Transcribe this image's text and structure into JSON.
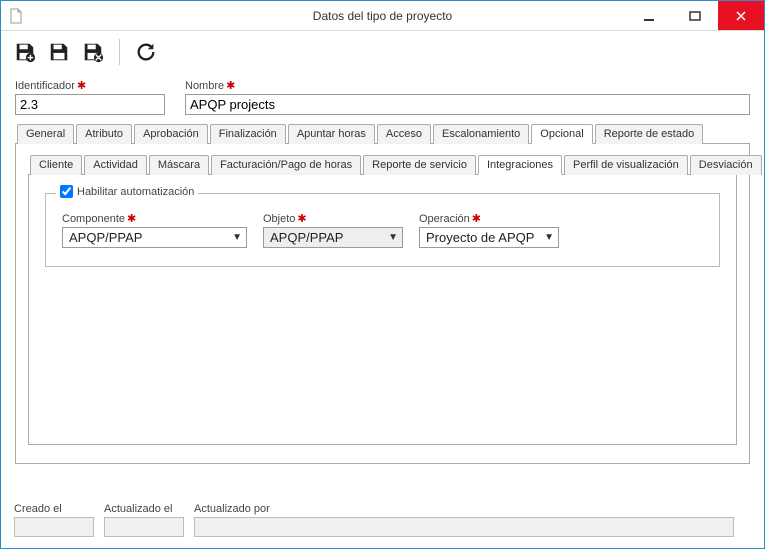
{
  "window": {
    "title": "Datos del tipo de proyecto"
  },
  "fields": {
    "id_label": "Identificador",
    "id_value": "2.3",
    "name_label": "Nombre",
    "name_value": "APQP projects"
  },
  "tabs_main": {
    "general": "General",
    "atributo": "Atributo",
    "aprobacion": "Aprobación",
    "finalizacion": "Finalización",
    "apuntar": "Apuntar horas",
    "acceso": "Acceso",
    "escalonamiento": "Escalonamiento",
    "opcional": "Opcional",
    "reporte_estado": "Reporte de estado"
  },
  "tabs_inner": {
    "cliente": "Cliente",
    "actividad": "Actividad",
    "mascara": "Máscara",
    "facturacion": "Facturación/Pago de horas",
    "reporte_servicio": "Reporte de servicio",
    "integraciones": "Integraciones",
    "perfil": "Perfil de visualización",
    "desviacion": "Desviación"
  },
  "automation": {
    "legend": "Habilitar automatización",
    "component_label": "Componente",
    "component_value": "APQP/PPAP",
    "object_label": "Objeto",
    "object_value": "APQP/PPAP",
    "operation_label": "Operación",
    "operation_value": "Proyecto de APQP"
  },
  "footer": {
    "creado": "Creado el",
    "actualizado": "Actualizado el",
    "por": "Actualizado por"
  }
}
